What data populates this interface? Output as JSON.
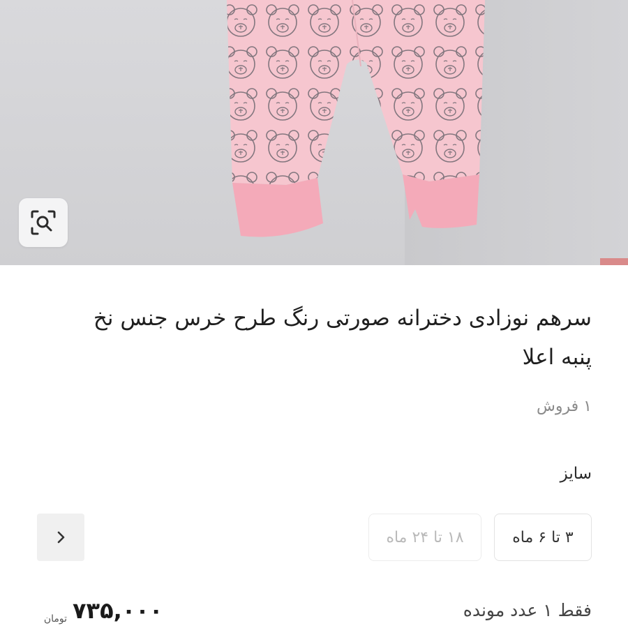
{
  "product": {
    "title": "سرهم نوزادی دخترانه صورتی رنگ طرح خرس جنس نخ پنبه اعلا",
    "sales_count": "۱ فروش"
  },
  "size": {
    "label": "سایز",
    "options": [
      {
        "label": "۳ تا ۶ ماه",
        "available": true
      },
      {
        "label": "۱۸ تا ۲۴ ماه",
        "available": false
      }
    ]
  },
  "stock": {
    "text": "فقط ۱ عدد مونده"
  },
  "price": {
    "amount": "۷۳۵,۰۰۰",
    "currency": "تومان"
  },
  "icons": {
    "lens": "image-search-icon",
    "next": "chevron-right-icon"
  },
  "colors": {
    "garment": "#f6c6cf",
    "pattern_stroke": "#6e6870"
  }
}
